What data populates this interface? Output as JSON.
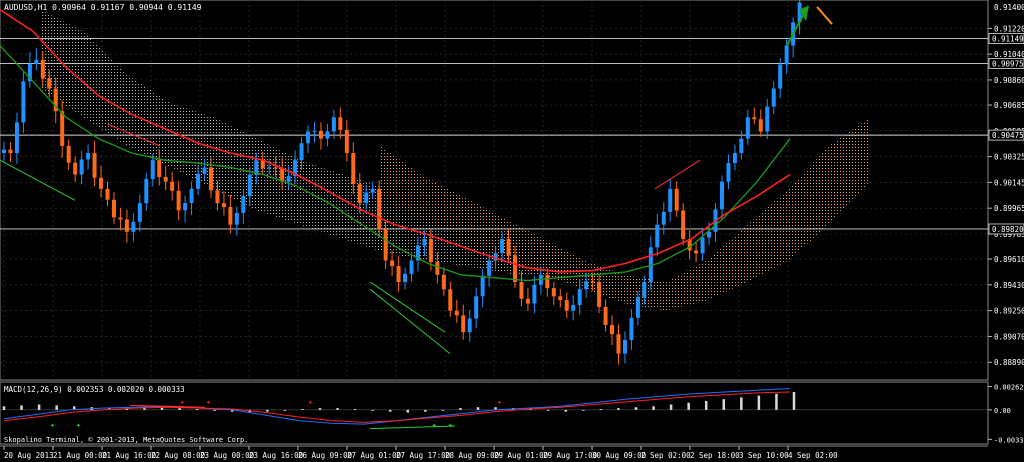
{
  "window": {
    "symbol_header": "AUDUSD,H1  0.90964 0.91167 0.90944 0.91149",
    "copyright": "Skopalino Terminal, © 2001-2013, MetaQuotes Software Corp."
  },
  "colors": {
    "background": "#000000",
    "grid": "#3a3a3a",
    "axis_text": "#ffffff",
    "bull_candle": "#1e90ff",
    "bear_candle": "#ff6a1a",
    "ma_fast": "#1a9a1a",
    "ma_slow": "#ff2020",
    "cloud_grey": "#c8c8c8",
    "cloud_orange": "#ffb070",
    "macd_hist": "#d8d8d8",
    "macd_line": "#1e6fff",
    "macd_signal": "#ff2020",
    "arrow_up": "#1aa01a",
    "arrow_down": "#ff8c1a"
  },
  "chart_data": [
    {
      "type": "candlestick",
      "title": "AUDUSD,H1",
      "ohlc_last": {
        "open": 0.90964,
        "high": 0.91167,
        "low": 0.90944,
        "close": 0.91149
      },
      "y_ticks": [
        0.9122,
        0.9104,
        0.9086,
        0.90685,
        0.90505,
        0.90325,
        0.90145,
        0.89965,
        0.89785,
        0.8961,
        0.8943,
        0.8925,
        0.8907,
        0.8889
      ],
      "ylim": [
        0.8878,
        0.9139
      ],
      "price_labels": [
        {
          "value": 0.91149,
          "text": "0.91149"
        },
        {
          "value": 0.90975,
          "text": "0.90975"
        },
        {
          "value": 0.90475,
          "text": "0.90475"
        },
        {
          "value": 0.8982,
          "text": "0.89820"
        }
      ],
      "top_label": "0.91400",
      "x_ticks": [
        "20 Aug 2013",
        "21 Aug 00:00",
        "21 Aug 16:00",
        "22 Aug 08:00",
        "23 Aug 00:00",
        "23 Aug 16:00",
        "26 Aug 09:00",
        "27 Aug 01:00",
        "27 Aug 17:00",
        "28 Aug 09:00",
        "29 Aug 01:00",
        "29 Aug 17:00",
        "30 Aug 09:00",
        "2 Sep 02:00",
        "2 Sep 18:00",
        "3 Sep 10:00",
        "4 Sep 02:00"
      ],
      "series": [
        {
          "kind": "candles",
          "close_path": [
            0.9035,
            0.9085,
            0.91,
            0.908,
            0.904,
            0.902,
            0.9035,
            0.901,
            0.899,
            0.898,
            0.9,
            0.903,
            0.9015,
            0.8995,
            0.901,
            0.9025,
            0.9,
            0.8985,
            0.9005,
            0.903,
            0.9025,
            0.9015,
            0.903,
            0.905,
            0.9045,
            0.906,
            0.9035,
            0.9,
            0.901,
            0.896,
            0.8945,
            0.896,
            0.8975,
            0.895,
            0.8925,
            0.891,
            0.8935,
            0.896,
            0.8975,
            0.8945,
            0.893,
            0.895,
            0.8935,
            0.8925,
            0.894,
            0.8945,
            0.8915,
            0.8895,
            0.892,
            0.8945,
            0.8985,
            0.901,
            0.8975,
            0.8965,
            0.898,
            0.9015,
            0.9035,
            0.906,
            0.905,
            0.908,
            0.911,
            0.914
          ],
          "noise": [
            0.0004,
            -0.0006,
            0.0008,
            -0.0005,
            0.0007,
            -0.0003,
            0.0005,
            -0.0008,
            0.0004,
            0.0006,
            -0.0005,
            0.0003,
            -0.0007,
            0.0006,
            -0.0004,
            0.0005,
            -0.0006,
            0.0008,
            -0.0003,
            0.0004,
            -0.0005,
            0.0007,
            -0.0006,
            0.0003,
            0.0005,
            -0.0004,
            0.0006,
            -0.0007,
            0.0004,
            -0.0005,
            0.0006,
            -0.0003,
            0.0005,
            -0.0006,
            0.0004,
            0.0007,
            -0.0005,
            0.0003,
            -0.0004,
            0.0006,
            -0.0007,
            0.0005,
            -0.0003,
            0.0004,
            -0.0006,
            0.0005,
            -0.0004,
            0.0006,
            -0.0005,
            0.0003,
            0.0007,
            -0.0006,
            0.0004,
            -0.0005,
            0.0006,
            -0.0003,
            0.0005,
            -0.0004,
            0.0006,
            0.0004,
            0.0003,
            0.0002
          ]
        },
        {
          "kind": "ma_fast",
          "name": "",
          "values": [
            0.911,
            0.9085,
            0.906,
            0.9045,
            0.9035,
            0.903,
            0.9028,
            0.9025,
            0.902,
            0.9012,
            0.9,
            0.8985,
            0.897,
            0.8958,
            0.895,
            0.8948,
            0.8946,
            0.8948,
            0.895,
            0.8952,
            0.8958,
            0.897,
            0.899,
            0.9015,
            0.9045
          ]
        },
        {
          "kind": "ma_slow",
          "name": "",
          "values": [
            0.9135,
            0.912,
            0.9095,
            0.9075,
            0.9062,
            0.9052,
            0.9042,
            0.9035,
            0.903,
            0.902,
            0.9008,
            0.8995,
            0.8985,
            0.8978,
            0.897,
            0.8962,
            0.8955,
            0.8952,
            0.8953,
            0.8958,
            0.8965,
            0.8975,
            0.8992,
            0.9005,
            0.902
          ]
        }
      ],
      "arrows": [
        {
          "direction": "up",
          "color_key": "arrow_up"
        },
        {
          "direction": "down",
          "color_key": "arrow_down"
        }
      ]
    },
    {
      "type": "macd",
      "title": "MACD(12,26,9) 0.002353 0.002020 0.000333",
      "y_ticks": [
        0.002622,
        0.0,
        -0.003305
      ],
      "y_tick_labels": [
        "0.002622",
        "0.00",
        "-0.003305"
      ],
      "ylim": [
        -0.0036,
        0.0029
      ],
      "histogram": [
        0.0004,
        0.0005,
        0.0006,
        0.0005,
        0.0004,
        0.0003,
        0.0002,
        0.0003,
        0.0004,
        0.0003,
        0.0002,
        0.0001,
        -0.0001,
        -0.0002,
        -0.0003,
        -0.0002,
        -0.0001,
        0.0001,
        0.0002,
        0.0002,
        0.0001,
        -0.0001,
        -0.0002,
        -0.0003,
        -0.0002,
        -0.0001,
        0.0002,
        0.0003,
        0.0003,
        0.0002,
        0.0001,
        -0.0001,
        -0.0002,
        -0.0001,
        0.0001,
        0.0002,
        0.0003,
        0.0004,
        0.0006,
        0.0008,
        0.001,
        0.0012,
        0.0014,
        0.0016,
        0.0018,
        0.002
      ],
      "macd_line": [
        -0.001,
        -0.0005,
        0.0,
        0.0002,
        0.0003,
        0.0004,
        0.0002,
        0.0,
        -0.0006,
        -0.0012,
        -0.0015,
        -0.0016,
        -0.0012,
        -0.0008,
        -0.0004,
        0.0,
        0.0002,
        0.0004,
        0.0008,
        0.0012,
        0.0015,
        0.0018,
        0.002,
        0.0022,
        0.0024
      ],
      "signal_line": [
        -0.0012,
        -0.0008,
        -0.0003,
        0.0,
        0.0002,
        0.0003,
        0.0002,
        0.0001,
        -0.0003,
        -0.0008,
        -0.0012,
        -0.0014,
        -0.0012,
        -0.0009,
        -0.0006,
        -0.0002,
        0.0001,
        0.0003,
        0.0006,
        0.0009,
        0.0012,
        0.0015,
        0.0017,
        0.0019,
        0.002
      ]
    }
  ]
}
